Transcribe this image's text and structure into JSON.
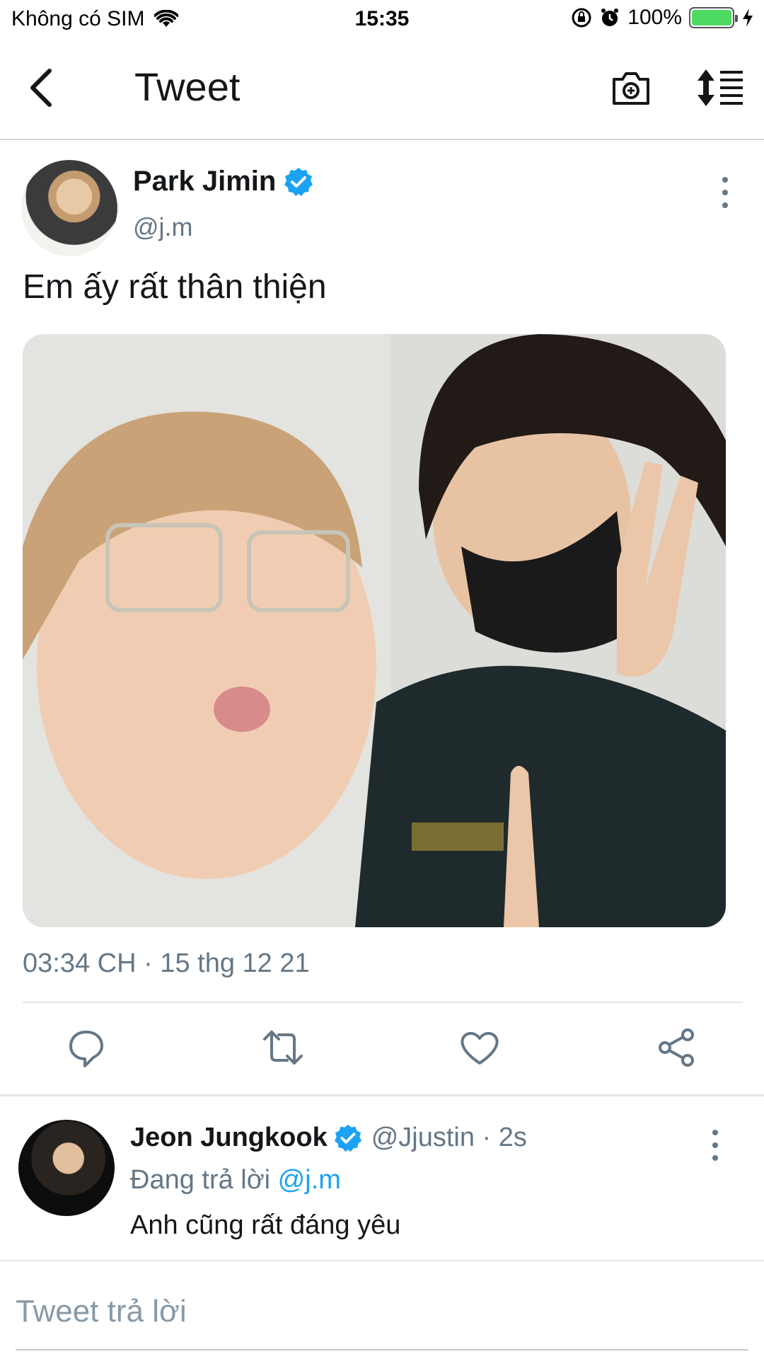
{
  "status_bar": {
    "carrier": "Không có SIM",
    "time": "15:35",
    "battery": "100%",
    "battery_level": 1.0,
    "icons": [
      "wifi-icon",
      "orientation-lock-icon",
      "alarm-icon",
      "battery-icon",
      "charging-icon"
    ]
  },
  "nav": {
    "title": "Tweet",
    "icons": [
      "back-icon",
      "camera-icon",
      "sort-icon"
    ]
  },
  "tweet": {
    "display_name": "Park Jimin",
    "handle": "@j.m",
    "text": "Em ấy rất thân thiện",
    "timestamp": "03:34 CH · 15 thg 12 21",
    "media_description": "selfie-photo",
    "actions": [
      "reply-icon",
      "retweet-icon",
      "like-icon",
      "share-icon"
    ]
  },
  "reply": {
    "display_name": "Jeon Jungkook",
    "handle_time": "@Jjustin · 2s",
    "replying_prefix": "Đang trả lời",
    "replying_mention": "@j.m",
    "text": "Anh cũng rất đáng yêu"
  },
  "composer": {
    "placeholder": "Tweet trả lời"
  },
  "colors": {
    "accent": "#1da1f2",
    "secondary_text": "#657786",
    "primary_text": "#14171a",
    "battery_green": "#4cd964"
  }
}
